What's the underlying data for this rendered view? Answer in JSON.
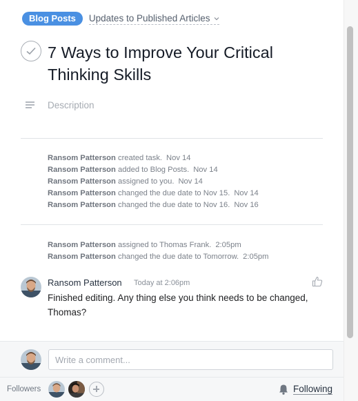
{
  "header": {
    "project_tag": "Blog Posts",
    "section": "Updates to Published Articles",
    "section_icon": "chevron-down-icon"
  },
  "task": {
    "title": "7 Ways to Improve Your Critical Thinking Skills",
    "description_placeholder": "Description"
  },
  "stories_group1": [
    {
      "actor": "Ransom Patterson",
      "action": "created task.",
      "time": "Nov 14"
    },
    {
      "actor": "Ransom Patterson",
      "action": "added to Blog Posts.",
      "time": "Nov 14"
    },
    {
      "actor": "Ransom Patterson",
      "action": "assigned to you.",
      "time": "Nov 14"
    },
    {
      "actor": "Ransom Patterson",
      "action": "changed the due date to Nov 15.",
      "time": "Nov 14"
    },
    {
      "actor": "Ransom Patterson",
      "action": "changed the due date to Nov 16.",
      "time": "Nov 16"
    }
  ],
  "stories_group2": [
    {
      "actor": "Ransom Patterson",
      "action": "assigned to Thomas Frank.",
      "time": "2:05pm"
    },
    {
      "actor": "Ransom Patterson",
      "action": "changed the due date to Tomorrow.",
      "time": "2:05pm"
    }
  ],
  "comment": {
    "author": "Ransom Patterson",
    "time": "Today at 2:06pm",
    "text": "Finished editing. Any thing else you think needs to be changed, Thomas?",
    "like_icon": "thumbs-up-icon"
  },
  "composer": {
    "placeholder": "Write a comment..."
  },
  "footer": {
    "followers_label": "Followers",
    "following_label": "Following",
    "bell_icon": "bell-icon",
    "add_icon": "plus-icon"
  },
  "colors": {
    "accent": "#4a90e2"
  }
}
